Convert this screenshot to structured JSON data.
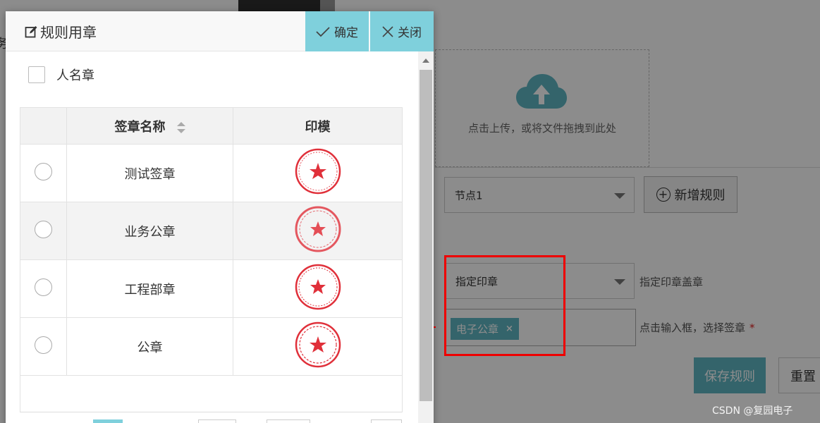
{
  "dialog": {
    "title": "规则用章",
    "confirm_label": "确定",
    "close_label": "关闭",
    "personal_seal_label": "人名章",
    "table": {
      "headers": [
        "签章名称",
        "印模"
      ],
      "rows": [
        {
          "name": "测试签章"
        },
        {
          "name": "业务公章"
        },
        {
          "name": "工程部章"
        },
        {
          "name": "公章"
        }
      ]
    }
  },
  "background": {
    "upload_hint": "点击上传，或将文件拖拽到此处",
    "node_select_value": "节点1",
    "add_rule_label": "新增规则",
    "seal_type_select_value": "指定印章",
    "seal_type_hint": "指定印章盖章",
    "selected_tag": "电子公章",
    "tag_remove_glyph": "×",
    "pick_hint": "点击输入框，选择签章",
    "required_mark": "*",
    "save_label": "保存规则",
    "reset_label": "重置",
    "colon": ":"
  },
  "watermark": "CSDN @复园电子",
  "colors": {
    "accent": "#7fd0dc",
    "tag": "#5fb6c4",
    "seal_red": "#e0303a",
    "highlight_red": "#ee0000"
  },
  "icons": [
    "edit-icon",
    "check-icon",
    "close-icon",
    "sort-icon",
    "cloud-upload-icon",
    "plus-circle-icon",
    "chevron-down-icon",
    "arrow-annotation"
  ]
}
